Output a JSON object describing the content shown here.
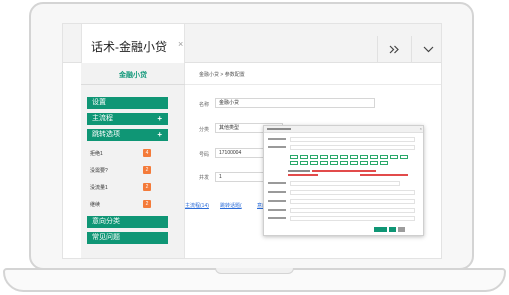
{
  "tab": {
    "title": "话术-金融小贷",
    "close": "×"
  },
  "toolbar": {
    "more_icon": "double-chevron-right",
    "dropdown_icon": "chevron-down"
  },
  "sidebar": {
    "title": "金融小贷",
    "sections": [
      {
        "label": "设置"
      },
      {
        "label": "主流程",
        "expand": "+"
      },
      {
        "label": "跳转选项",
        "expand": "+"
      },
      {
        "label": "意向分类"
      },
      {
        "label": "常见问题"
      }
    ],
    "items": [
      {
        "label": "拒绝1",
        "count": "4"
      },
      {
        "label": "没需要?",
        "count": "2"
      },
      {
        "label": "没流量1",
        "count": "2"
      },
      {
        "label": "继续",
        "count": "2"
      }
    ]
  },
  "main": {
    "breadcrumb": "金融小贷 > 参数配置",
    "fields": [
      {
        "label": "名称",
        "value": "金融小贷"
      },
      {
        "label": "分类",
        "value": "其他类型"
      },
      {
        "label": "号码",
        "value": "17100004"
      },
      {
        "label": "并发",
        "value": "1"
      }
    ],
    "links": [
      "主流程(14)",
      "跳转话题(",
      "意向"
    ]
  },
  "colors": {
    "accent": "#0f9675",
    "badge": "#f47b3a",
    "link": "#2b6cd8",
    "title": "#169a7c"
  }
}
